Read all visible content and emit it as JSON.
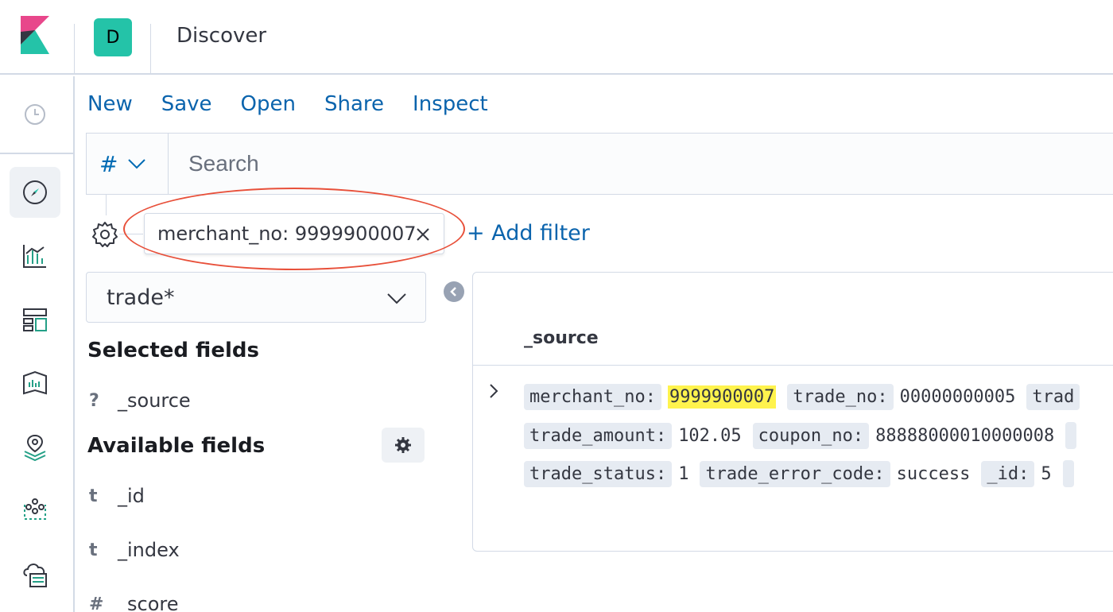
{
  "header": {
    "avatar_letter": "D",
    "title": "Discover"
  },
  "nav": {
    "items": [
      {
        "name": "recently-viewed",
        "icon": "clock-icon"
      },
      {
        "name": "discover",
        "icon": "compass-icon",
        "active": true
      },
      {
        "name": "visualize",
        "icon": "visualize-icon"
      },
      {
        "name": "dashboard",
        "icon": "dashboard-icon"
      },
      {
        "name": "canvas",
        "icon": "canvas-icon"
      },
      {
        "name": "maps",
        "icon": "maps-icon"
      },
      {
        "name": "ml",
        "icon": "machine-learning-icon"
      },
      {
        "name": "infrastructure",
        "icon": "infrastructure-icon"
      }
    ]
  },
  "topmenu": {
    "new": "New",
    "save": "Save",
    "open": "Open",
    "share": "Share",
    "inspect": "Inspect"
  },
  "querybar": {
    "language_symbol": "#",
    "search_placeholder": "Search"
  },
  "filters": [
    {
      "label": "merchant_no: 9999900007"
    }
  ],
  "add_filter_label": "+ Add filter",
  "index_pattern": "trade*",
  "sidebar": {
    "selected_title": "Selected fields",
    "selected_fields": [
      {
        "type": "?",
        "name": "_source"
      }
    ],
    "available_title": "Available fields",
    "available_fields": [
      {
        "type": "t",
        "name": "_id"
      },
      {
        "type": "t",
        "name": "_index"
      },
      {
        "type": "#",
        "name": "_score"
      }
    ]
  },
  "doc_table": {
    "column": "_source",
    "rows": [
      [
        {
          "k": "merchant_no:",
          "v": "9999900007",
          "highlight": true
        },
        {
          "k": "trade_no:",
          "v": "00000000005"
        },
        {
          "k": "trad",
          "v": ""
        }
      ],
      [
        {
          "k": "trade_amount:",
          "v": "102.05"
        },
        {
          "k": "coupon_no:",
          "v": "88888000010000008"
        },
        {
          "k": "",
          "v": ""
        }
      ],
      [
        {
          "k": "trade_status:",
          "v": "1"
        },
        {
          "k": "trade_error_code:",
          "v": "success"
        },
        {
          "k": "_id:",
          "v": "5"
        },
        {
          "k": "",
          "v": ""
        }
      ]
    ]
  },
  "colors": {
    "link": "#0b64ad",
    "highlight": "#fff34d",
    "annotation_circle": "#e8503a",
    "avatar_bg": "#24c3a8"
  }
}
